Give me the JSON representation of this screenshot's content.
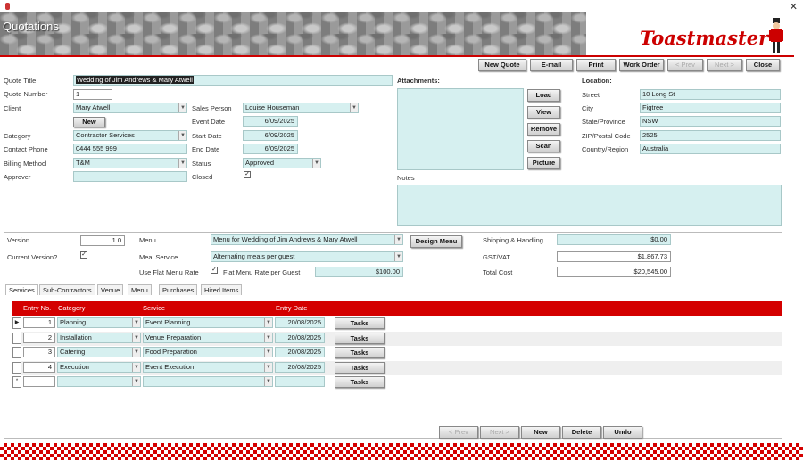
{
  "app": {
    "title": "Quotations",
    "logo": "Toastmaster"
  },
  "toolbar": [
    "New Quote",
    "E-mail",
    "Print",
    "Work Order",
    "< Prev",
    "Next >",
    "Close"
  ],
  "quote": {
    "title_label": "Quote Title",
    "title": "Wedding of Jim Andrews & Mary Atwell",
    "number_label": "Quote Number",
    "number": "1",
    "client_label": "Client",
    "client": "Mary Atwell",
    "new_label": "New",
    "category_label": "Category",
    "category": "Contractor Services",
    "phone_label": "Contact Phone",
    "phone": "0444 555 999",
    "billing_label": "Billing Method",
    "billing": "T&M",
    "approver_label": "Approver",
    "approver": "",
    "salesperson_label": "Sales Person",
    "salesperson": "Louise Houseman",
    "event_date_label": "Event Date",
    "event_date": "6/09/2025",
    "start_date_label": "Start Date",
    "start_date": "6/09/2025",
    "end_date_label": "End Date",
    "end_date": "6/09/2025",
    "status_label": "Status",
    "status": "Approved",
    "closed_label": "Closed",
    "closed": true
  },
  "attachments": {
    "label": "Attachments:",
    "buttons": [
      "Load",
      "View",
      "Remove",
      "Scan",
      "Picture"
    ],
    "notes_label": "Notes"
  },
  "location": {
    "label": "Location:",
    "fields": [
      {
        "label": "Street",
        "value": "10 Long St"
      },
      {
        "label": "City",
        "value": "Figtree"
      },
      {
        "label": "State/Province",
        "value": "NSW"
      },
      {
        "label": "ZIP/Postal Code",
        "value": "2525"
      },
      {
        "label": "Country/Region",
        "value": "Australia"
      }
    ]
  },
  "version": {
    "version_label": "Version",
    "version": "1.0",
    "current_label": "Current Version?",
    "current": true,
    "menu_label": "Menu",
    "menu": "Menu for Wedding of Jim Andrews & Mary Atwell",
    "design_menu": "Design Menu",
    "meal_label": "Meal Service",
    "meal": "Alternating meals per guest",
    "flat_label": "Use Flat Menu Rate",
    "flat": true,
    "flat_rate_label": "Flat Menu Rate per Guest",
    "flat_rate": "$100.00",
    "shipping_label": "Shipping & Handling",
    "shipping": "$0.00",
    "gst_label": "GST/VAT",
    "gst": "$1,867.73",
    "total_label": "Total Cost",
    "total": "$20,545.00"
  },
  "tabs": [
    "Services",
    "Sub-Contractors",
    "Venue",
    "Menu",
    "Purchases",
    "Hired Items"
  ],
  "grid": {
    "headers": [
      "Entry No.",
      "Category",
      "Service",
      "Entry Date"
    ],
    "tasks_label": "Tasks",
    "rows": [
      {
        "no": "1",
        "category": "Planning",
        "service": "Event Planning",
        "date": "20/08/2025"
      },
      {
        "no": "2",
        "category": "Installation",
        "service": "Venue Preparation",
        "date": "20/08/2025"
      },
      {
        "no": "3",
        "category": "Catering",
        "service": "Food Preparation",
        "date": "20/08/2025"
      },
      {
        "no": "4",
        "category": "Execution",
        "service": "Event Execution",
        "date": "20/08/2025"
      }
    ]
  },
  "bottom_nav": [
    "< Prev",
    "Next >",
    "New",
    "Delete",
    "Undo"
  ],
  "colors": {
    "accent": "#d40000",
    "field": "#d6f0f0"
  }
}
